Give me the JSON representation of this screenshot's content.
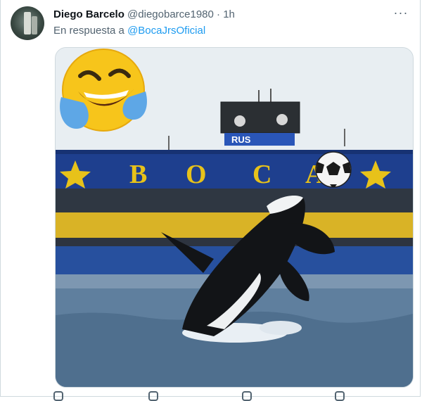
{
  "tweet": {
    "author_name": "Diego Barcelo",
    "author_handle": "@diegobarce1980",
    "separator": "·",
    "time": "1h",
    "more_label": "···",
    "reply_prefix": "En respuesta a",
    "reply_to": "@BocaJrsOficial"
  },
  "media": {
    "scoreboard_text": "RUS",
    "stadium_letters": [
      "B",
      "O",
      "C",
      "A"
    ]
  },
  "colors": {
    "link": "#1d9bf0",
    "secondary_text": "#536471",
    "border": "#cfd9de",
    "boca_blue": "#1e3f8e",
    "boca_yellow": "#e7c21a"
  },
  "icons": [
    "laughing-emoji-icon",
    "soccer-ball-icon",
    "more-options-icon"
  ]
}
